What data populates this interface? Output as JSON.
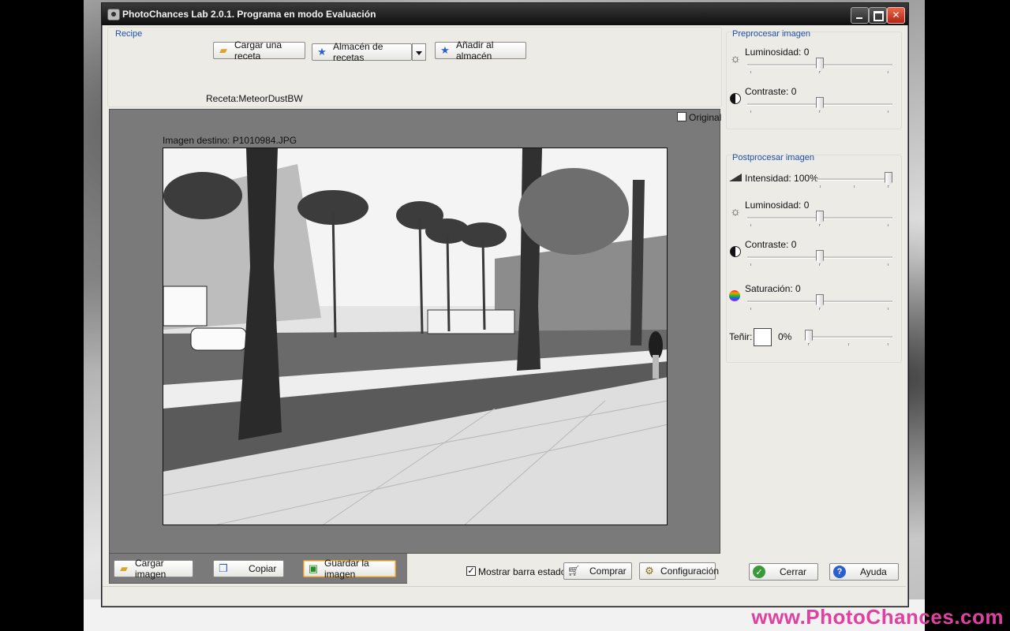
{
  "window": {
    "title": "PhotoChances Lab 2.0.1. Programa en modo Evaluación"
  },
  "recipe": {
    "group_label": "Recipe",
    "load_recipe_label": "Cargar una receta",
    "recipe_store_label": "Almacén de recetas",
    "add_to_store_label": "Añadir al almacén",
    "current_recipe": "Receta:MeteorDustBW"
  },
  "preview": {
    "original_label": "Original",
    "original_checked": false,
    "target_image_label": "Imagen destino: P1010984.JPG"
  },
  "preprocess": {
    "group_label": "Preprocesar imagen",
    "brightness_label": "Luminosidad: 0",
    "brightness_value": 0,
    "contrast_label": "Contraste: 0",
    "contrast_value": 0
  },
  "postprocess": {
    "group_label": "Postprocesar imagen",
    "intensity_label": "Intensidad: 100%",
    "intensity_value": 100,
    "brightness_label": "Luminosidad: 0",
    "brightness_value": 0,
    "contrast_label": "Contraste: 0",
    "contrast_value": 0,
    "saturation_label": "Saturación: 0",
    "saturation_value": 0,
    "tint_label": "Teñir:",
    "tint_percent": "0%",
    "tint_value": 0,
    "tint_color": "#ffffff"
  },
  "bottom": {
    "load_image_label": "Cargar imagen",
    "copy_label": "Copiar",
    "save_image_label": "Guardar la imagen",
    "show_status_bar_label": "Mostrar barra estado",
    "show_status_bar_checked": true,
    "buy_label": "Comprar",
    "settings_label": "Configuración",
    "close_label": "Cerrar",
    "help_label": "Ayuda"
  },
  "watermark": "www.PhotoChances.com",
  "colors": {
    "group_label": "#1f4fa8",
    "canvas_bg": "#7a7a7a",
    "watermark": "#e040a0"
  }
}
